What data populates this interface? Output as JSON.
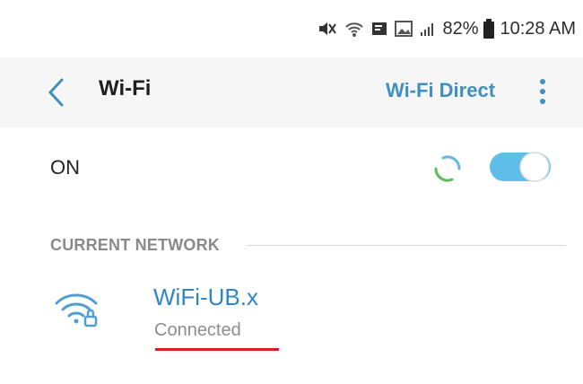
{
  "status_bar": {
    "battery_percent": "82%",
    "time": "10:28 AM",
    "icons": [
      "mute-vibrate-icon",
      "wifi-signal-icon",
      "notification-icon",
      "image-icon",
      "cell-signal-icon",
      "battery-icon"
    ]
  },
  "header": {
    "title": "Wi-Fi",
    "wifi_direct_label": "Wi-Fi Direct"
  },
  "wifi_toggle": {
    "label": "ON",
    "is_on": true,
    "accent_color": "#5fbee9"
  },
  "current_network": {
    "section_label": "CURRENT NETWORK",
    "name": "WiFi-UB.x",
    "status": "Connected",
    "name_color": "#2f86c4"
  },
  "colors": {
    "accent_blue": "#3f8fc2",
    "spinner_green": "#5bbd5b",
    "spinner_blue": "#63b7e5",
    "underline_red": "#d81b25"
  }
}
